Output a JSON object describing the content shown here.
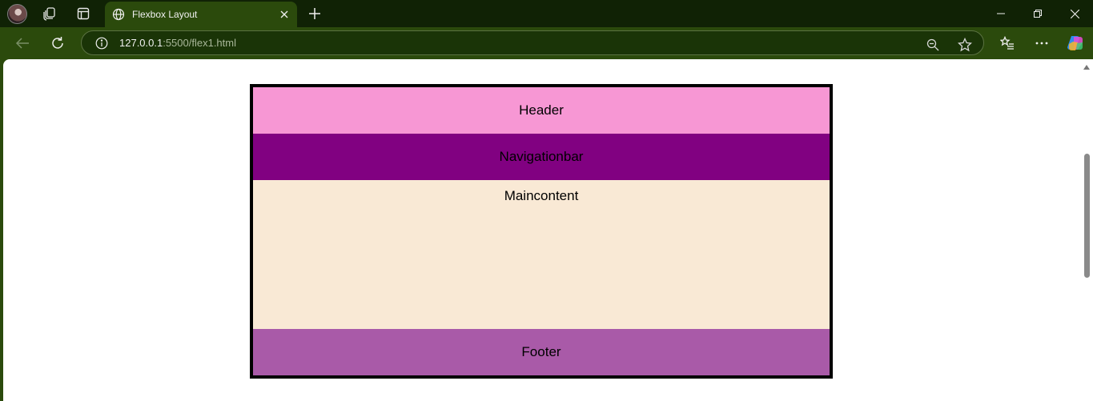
{
  "browser": {
    "tab": {
      "title": "Flexbox Layout"
    },
    "address": {
      "host": "127.0.0.1",
      "rest": ":5500/flex1.html"
    }
  },
  "page": {
    "header": "Header",
    "navbar": "Navigationbar",
    "main": "Maincontent",
    "footer": "Footer",
    "colors": {
      "header": "#f797d4",
      "navbar": "#810181",
      "main": "#f9e9d5",
      "footer": "#a95aa8",
      "border": "#000000"
    }
  },
  "icons": [
    "profile-avatar",
    "workspaces-icon",
    "tab-actions-icon",
    "globe-icon",
    "close-icon",
    "plus-icon",
    "minimize-icon",
    "restore-icon",
    "window-close-icon",
    "back-arrow-icon",
    "refresh-icon",
    "info-icon",
    "zoom-out-icon",
    "favorite-star-icon",
    "favorites-list-icon",
    "more-icon",
    "copilot-icon"
  ]
}
